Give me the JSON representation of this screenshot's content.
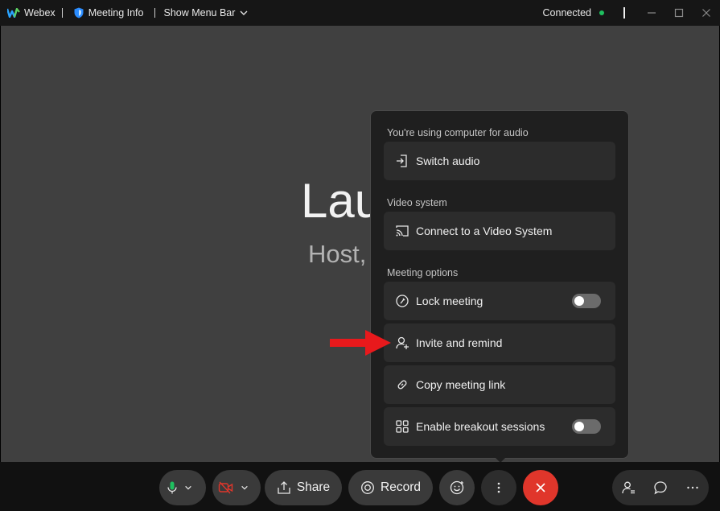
{
  "titlebar": {
    "app_name": "Webex",
    "meeting_info": "Meeting Info",
    "show_menu_bar": "Show Menu Bar",
    "status": "Connected",
    "status_color": "#1fbf5f"
  },
  "stage": {
    "name_partial": "Lau",
    "role_partial": "Host,"
  },
  "menu": {
    "audio_section": "You're using computer for audio",
    "switch_audio": "Switch audio",
    "video_section": "Video system",
    "connect_video": "Connect to a Video System",
    "options_section": "Meeting options",
    "lock_meeting": "Lock meeting",
    "lock_meeting_on": false,
    "invite_remind": "Invite and remind",
    "copy_link": "Copy meeting link",
    "breakout": "Enable breakout sessions",
    "breakout_on": false
  },
  "controls": {
    "share_label": "Share",
    "record_label": "Record",
    "video_muted_color": "#e0362b",
    "end_color": "#e0362b"
  },
  "colors": {
    "arrow": "#e8191c",
    "accent_green": "#1fbf5f"
  }
}
